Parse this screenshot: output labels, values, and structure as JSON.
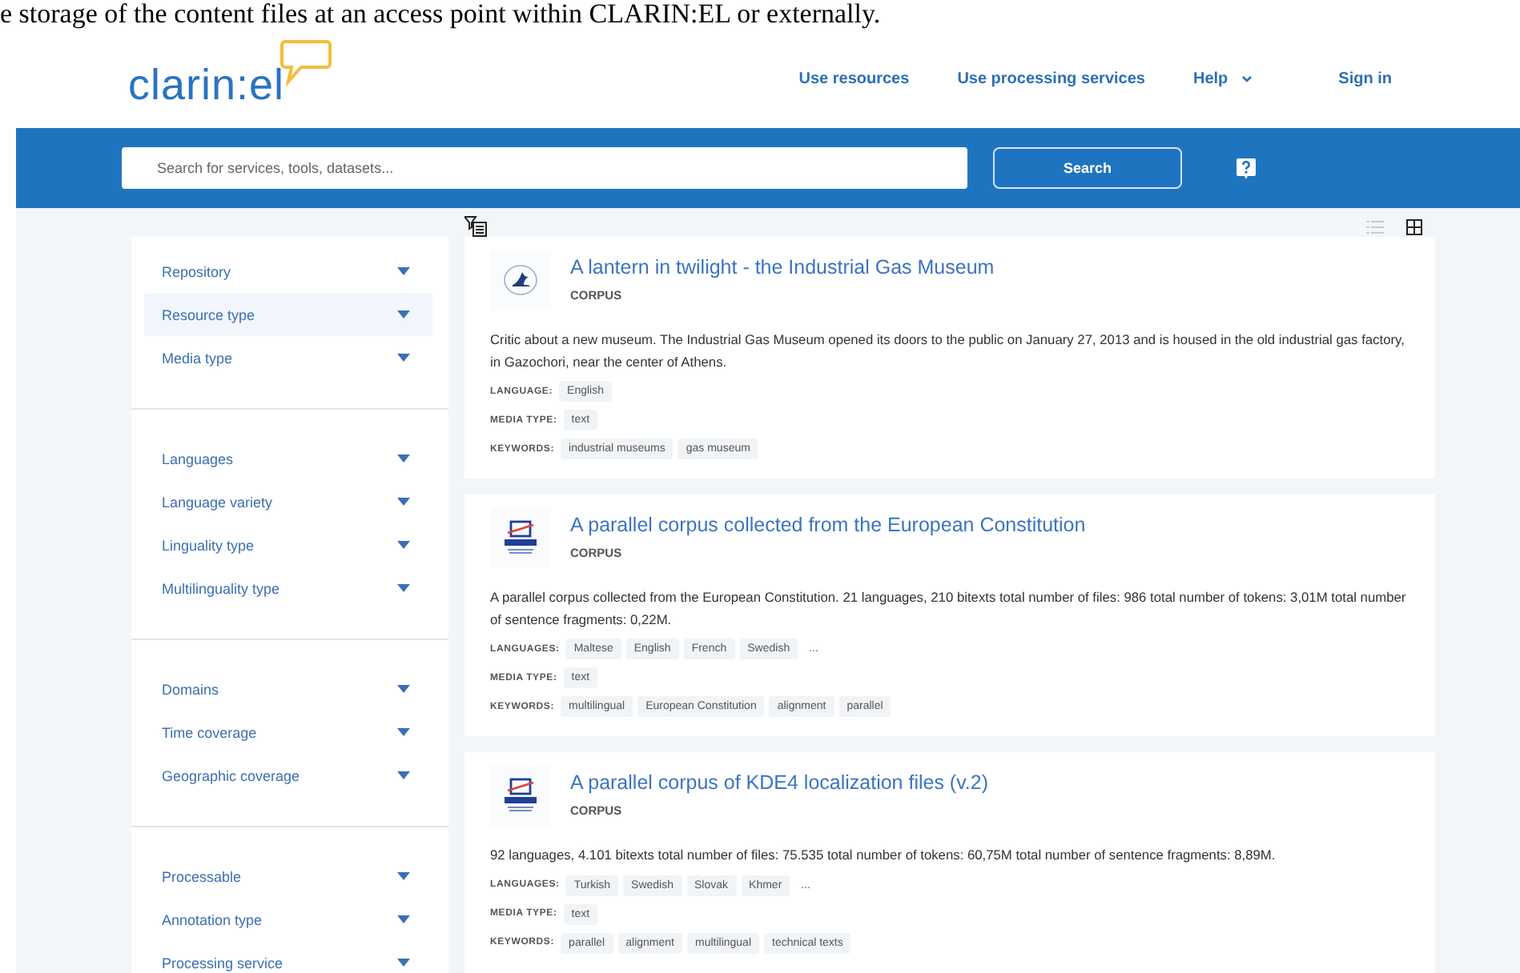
{
  "document_text": "e storage of the content files at an access point within CLARIN:EL or externally.",
  "header": {
    "logo": "clarin:el",
    "nav": [
      {
        "label": "Use resources",
        "kind": "link"
      },
      {
        "label": "Use processing services",
        "kind": "link"
      },
      {
        "label": "Help",
        "kind": "dropdown"
      },
      {
        "label": "Sign in",
        "kind": "link"
      }
    ]
  },
  "search": {
    "placeholder": "Search for services, tools, datasets...",
    "button": "Search"
  },
  "view_modes": [
    {
      "kind": "list",
      "selected": false
    },
    {
      "kind": "grid",
      "selected": true
    }
  ],
  "facets": [
    [
      {
        "label": "Repository",
        "highlighted": false
      },
      {
        "label": "Resource type",
        "highlighted": true
      },
      {
        "label": "Media type",
        "highlighted": false
      }
    ],
    [
      {
        "label": "Languages",
        "highlighted": false
      },
      {
        "label": "Language variety",
        "highlighted": false
      },
      {
        "label": "Linguality type",
        "highlighted": false
      },
      {
        "label": "Multilinguality type",
        "highlighted": false
      }
    ],
    [
      {
        "label": "Domains",
        "highlighted": false
      },
      {
        "label": "Time coverage",
        "highlighted": false
      },
      {
        "label": "Geographic coverage",
        "highlighted": false
      }
    ],
    [
      {
        "label": "Processable",
        "highlighted": false
      },
      {
        "label": "Annotation type",
        "highlighted": false
      },
      {
        "label": "Processing service",
        "highlighted": false
      }
    ]
  ],
  "results": [
    {
      "kind": "emblem",
      "title": "A lantern in twilight - the Industrial Gas Museum",
      "type": "CORPUS",
      "description": "Critic about a new museum. The Industrial Gas Museum opened its doors to the public on January 27, 2013 and is housed in the old industrial gas factory, in Gazochori, near the center of Athens.",
      "fields": [
        {
          "label": "LANGUAGE:",
          "tags": [
            "English"
          ]
        },
        {
          "label": "MEDIA TYPE:",
          "tags": [
            "text"
          ]
        },
        {
          "label": "KEYWORDS:",
          "tags": [
            "industrial museums",
            "gas museum"
          ]
        }
      ]
    },
    {
      "kind": "athena",
      "title": "A parallel corpus collected from the European Constitution",
      "type": "CORPUS",
      "description": "A parallel corpus collected from the European Constitution. 21 languages, 210 bitexts total number of files: 986 total number of tokens: 3,01M total number of sentence fragments: 0,22M.",
      "fields": [
        {
          "label": "LANGUAGES:",
          "tags": [
            "Maltese",
            "English",
            "French",
            "Swedish"
          ],
          "more": "..."
        },
        {
          "label": "MEDIA TYPE:",
          "tags": [
            "text"
          ]
        },
        {
          "label": "KEYWORDS:",
          "tags": [
            "multilingual",
            "European Constitution",
            "alignment",
            "parallel"
          ]
        }
      ]
    },
    {
      "kind": "athena",
      "title": "A parallel corpus of KDE4 localization files (v.2)",
      "type": "CORPUS",
      "description": "92 languages, 4.101 bitexts total number of files: 75.535 total number of tokens: 60,75M total number of sentence fragments: 8,89M.",
      "fields": [
        {
          "label": "LANGUAGES:",
          "tags": [
            "Turkish",
            "Swedish",
            "Slovak",
            "Khmer"
          ],
          "more": "..."
        },
        {
          "label": "MEDIA TYPE:",
          "tags": [
            "text"
          ]
        },
        {
          "label": "KEYWORDS:",
          "tags": [
            "parallel",
            "alignment",
            "multilingual",
            "technical texts"
          ]
        }
      ]
    }
  ]
}
